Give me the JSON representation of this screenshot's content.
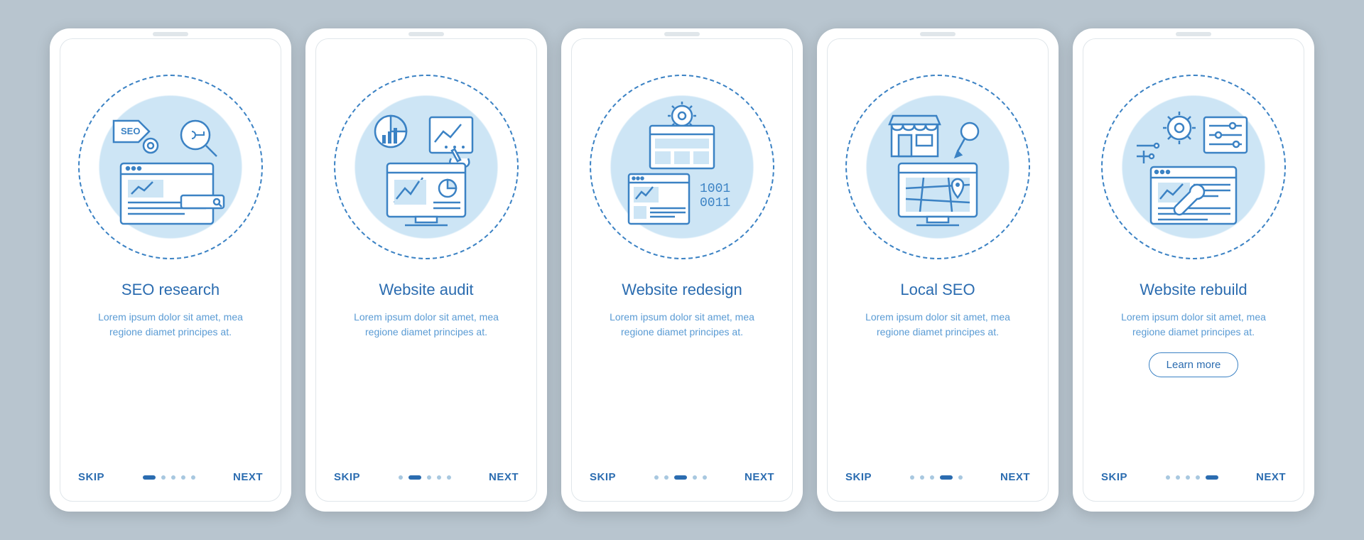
{
  "colors": {
    "primary": "#2b6cb0",
    "accent": "#3b82c4",
    "background": "#b8c5cf",
    "illustration_fill": "#cde5f5"
  },
  "common": {
    "skip_label": "SKIP",
    "next_label": "NEXT",
    "learn_more_label": "Learn more",
    "description": "Lorem ipsum dolor sit amet, mea regione diamet principes at."
  },
  "screens": [
    {
      "title": "SEO research",
      "illustration": "seo-research",
      "active_dot": 0,
      "has_learn_more": false
    },
    {
      "title": "Website audit",
      "illustration": "website-audit",
      "active_dot": 1,
      "has_learn_more": false
    },
    {
      "title": "Website redesign",
      "illustration": "website-redesign",
      "active_dot": 2,
      "has_learn_more": false
    },
    {
      "title": "Local SEO",
      "illustration": "local-seo",
      "active_dot": 3,
      "has_learn_more": false
    },
    {
      "title": "Website rebuild",
      "illustration": "website-rebuild",
      "active_dot": 4,
      "has_learn_more": true
    }
  ],
  "icons": {
    "seo-research": [
      "tag-icon",
      "gear-icon",
      "key-icon",
      "magnifier-icon",
      "browser-window-icon",
      "search-bar-icon"
    ],
    "website-audit": [
      "pie-chart-icon",
      "bar-chart-icon",
      "document-graph-icon",
      "hand-pointer-icon",
      "monitor-icon",
      "analytics-icon"
    ],
    "website-redesign": [
      "gear-icon",
      "layout-window-icon",
      "image-window-icon",
      "binary-code-icon"
    ],
    "local-seo": [
      "storefront-icon",
      "pushpin-icon",
      "monitor-icon",
      "map-icon",
      "location-pin-icon"
    ],
    "website-rebuild": [
      "sliders-icon",
      "gear-icon",
      "circuit-icon",
      "browser-window-icon",
      "wrench-icon"
    ]
  },
  "binary_text": "1001\n0011"
}
